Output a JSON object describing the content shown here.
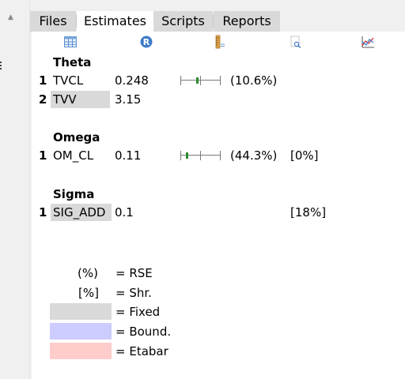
{
  "tabs": [
    {
      "label": "Files",
      "active": false
    },
    {
      "label": "Estimates",
      "active": true
    },
    {
      "label": "Scripts",
      "active": false
    },
    {
      "label": "Reports",
      "active": false
    }
  ],
  "toolbar_icons": [
    "table-icon",
    "r-logo-icon",
    "ruler-icon",
    "document-search-icon",
    "chart-icon"
  ],
  "sections": {
    "theta": {
      "title": "Theta",
      "rows": [
        {
          "index": "1",
          "name": "TVCL",
          "value": "0.248",
          "rse": "(10.6%)",
          "rse_fraction": 0.106,
          "fixed": false
        },
        {
          "index": "2",
          "name": "TVV",
          "value": "3.15",
          "fixed": true
        }
      ]
    },
    "omega": {
      "title": "Omega",
      "rows": [
        {
          "index": "1",
          "name": "OM_CL",
          "value": "0.11",
          "rse": "(44.3%)",
          "shrinkage": "[0%]",
          "rse_fraction": 0.443,
          "fixed": false
        }
      ]
    },
    "sigma": {
      "title": "Sigma",
      "rows": [
        {
          "index": "1",
          "name": "SIG_ADD",
          "value": "0.1",
          "shrinkage": "[18%]",
          "fixed": true
        }
      ]
    }
  },
  "legend": {
    "rse_symbol": "(%)",
    "rse_label": "= RSE",
    "shr_symbol": "[%]",
    "shr_label": "= Shr.",
    "fixed_label": "= Fixed",
    "bound_label": "= Bound.",
    "etabar_label": "= Etabar"
  },
  "colors": {
    "fixed": "#d9d9d9",
    "bound": "#ccccff",
    "etabar": "#ffcccc",
    "rse_marker": "#2e8b2e"
  }
}
